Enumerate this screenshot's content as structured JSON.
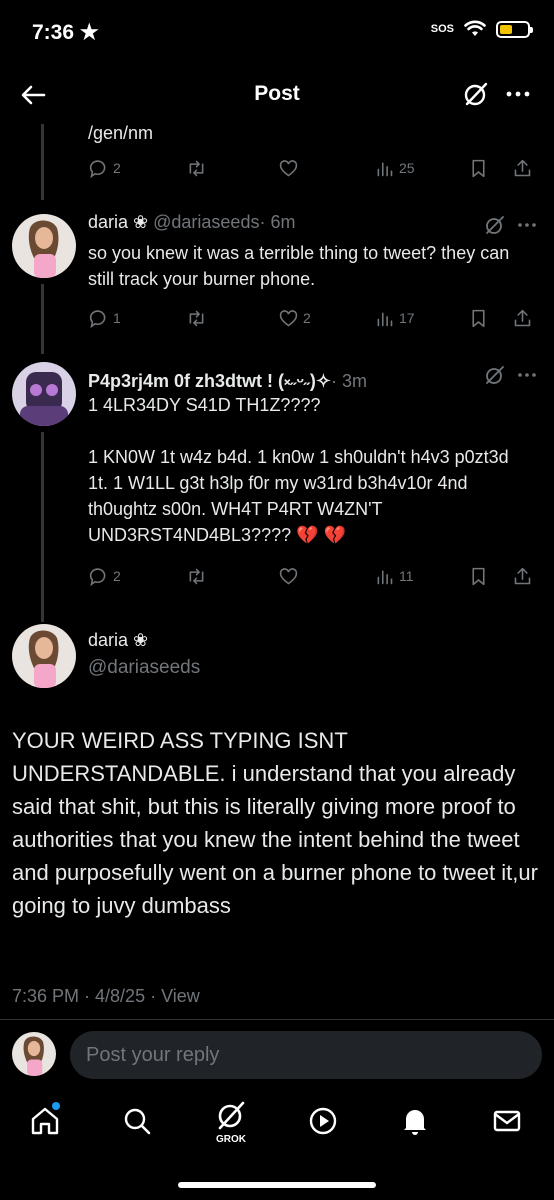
{
  "status_bar": {
    "time": "7:36",
    "sos": "SOS"
  },
  "header": {
    "title": "Post"
  },
  "top_post": {
    "text_tail": "/gen/nm",
    "replies": "2",
    "views": "25"
  },
  "reply_1": {
    "name": "daria ❀",
    "handle": "@dariaseeds",
    "time": "· 6m",
    "text": "so you knew it was a terrible thing to tweet? they can still track your burner phone.",
    "replies": "1",
    "likes": "2",
    "views": "17"
  },
  "reply_2": {
    "name": "P4p3rj4m 0f zh3dtwt ! (༝˶ᵕ˶)✧",
    "time": "· 3m",
    "text": "1 4LR34DY S41D TH1Z????\n\n1 KN0W 1t w4z b4d. 1 kn0w 1 sh0uldn't h4v3 p0zt3d 1t. 1 W1LL g3t h3lp f0r my w31rd b3h4v10r 4nd th0ughtz s00n. WH4T P4RT W4ZN'T UND3RST4ND4BL3???? 💔 💔",
    "replies": "2",
    "views": "11"
  },
  "main_post": {
    "name": "daria ❀",
    "handle": "@dariaseeds",
    "text": "YOUR WEIRD ASS TYPING ISNT UNDERSTANDABLE. i understand that you already said that shit, but this is literally giving more proof to authorities that you knew the intent behind the tweet and purposefully went on a burner phone to tweet it,ur going to juvy dumbass",
    "meta": "7:36 PM · 4/8/25 · View"
  },
  "reply_box": {
    "placeholder": "Post your reply"
  },
  "tab_bar": {
    "grok_label": "GROK"
  },
  "colors": {
    "background": "#000000",
    "text": "#e7e9ea",
    "muted": "#71767b",
    "accent": "#1d9bf0"
  }
}
